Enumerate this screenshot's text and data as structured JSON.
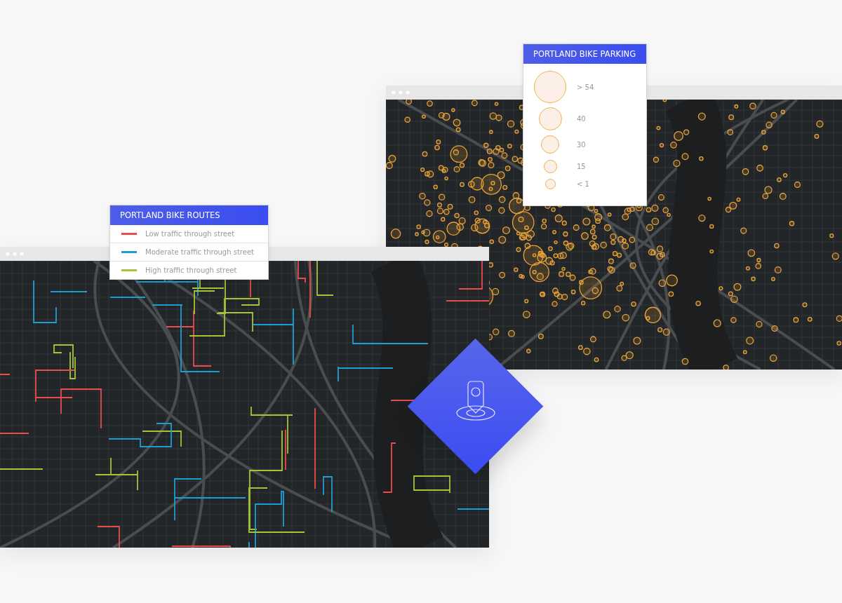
{
  "route_legend": {
    "title": "PORTLAND BIKE ROUTES",
    "items": [
      {
        "label": "Low traffic through street",
        "color": "#e84c4c"
      },
      {
        "label": "Moderate traffic through street",
        "color": "#1d9ed3"
      },
      {
        "label": "High traffic through street",
        "color": "#a6c437"
      }
    ]
  },
  "parking_legend": {
    "title": "PORTLAND BIKE PARKING",
    "items": [
      {
        "label": "> 54"
      },
      {
        "label": "40"
      },
      {
        "label": "30"
      },
      {
        "label": "15"
      },
      {
        "label": "< 1"
      }
    ]
  }
}
